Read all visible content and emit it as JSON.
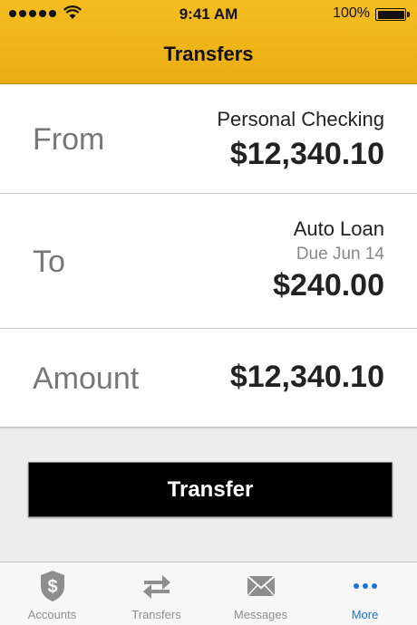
{
  "status_bar": {
    "time": "9:41 AM",
    "battery": "100%"
  },
  "nav": {
    "title": "Transfers"
  },
  "from": {
    "label": "From",
    "account": "Personal Checking",
    "amount": "$12,340.10"
  },
  "to": {
    "label": "To",
    "account": "Auto Loan",
    "due": "Due Jun 14",
    "amount": "$240.00"
  },
  "amount": {
    "label": "Amount",
    "value": "$12,340.10"
  },
  "transfer_button": {
    "label": "Transfer"
  },
  "tabbar": {
    "items": [
      {
        "label": "Accounts",
        "icon": "dollar-shield-icon",
        "active": false
      },
      {
        "label": "Transfers",
        "icon": "transfer-arrows-icon",
        "active": false
      },
      {
        "label": "Messages",
        "icon": "envelope-icon",
        "active": false
      },
      {
        "label": "More",
        "icon": "more-dots-icon",
        "active": true
      }
    ]
  },
  "colors": {
    "header": "#f0b618",
    "accent": "#1a73d9",
    "button": "#000000"
  }
}
